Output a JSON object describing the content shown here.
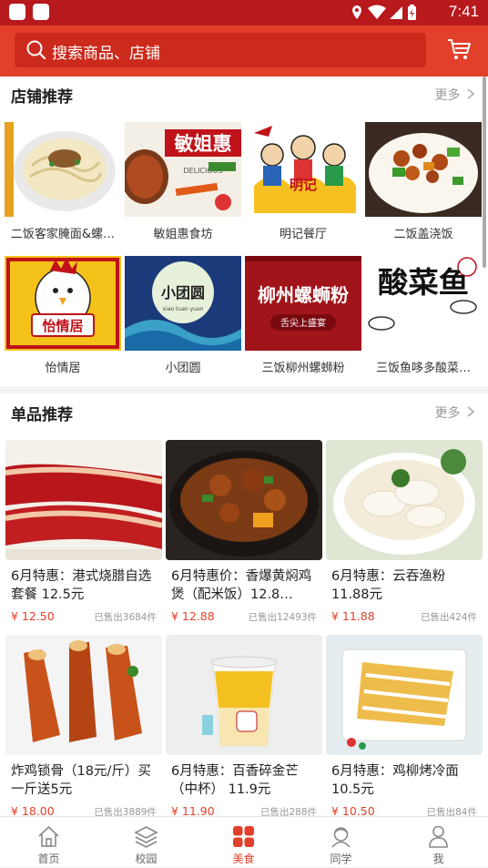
{
  "status_bar": {
    "time": "7:41"
  },
  "search": {
    "placeholder": "搜索商品、店铺"
  },
  "shops_section": {
    "title": "店铺推荐",
    "more": "更多",
    "shops": [
      {
        "name": "二饭客家腌面&螺…"
      },
      {
        "name": "敏姐惠食坊",
        "sign": "敏姐惠",
        "sub": "DELICIOUS"
      },
      {
        "name": "明记餐厅",
        "sign": "明记"
      },
      {
        "name": "二饭盖浇饭"
      },
      {
        "name": "怡情居",
        "sign": "怡情居"
      },
      {
        "name": "小团圆",
        "sign": "小团圆",
        "sub": "xiao tuan yuan"
      },
      {
        "name": "三饭柳州螺蛳粉",
        "sign": "柳州螺蛳粉",
        "sub": "舌尖上盛宴"
      },
      {
        "name": "三饭鱼哆多酸菜…",
        "sign": "酸菜鱼"
      }
    ]
  },
  "products_section": {
    "title": "单品推荐",
    "more": "更多",
    "products": [
      {
        "title": "6月特惠：港式烧腊自选套餐 12.5元",
        "price": "¥ 12.50",
        "sold": "已售出3684件"
      },
      {
        "title": "6月特惠价：香爆黄焖鸡煲（配米饭）12.8…",
        "price": "¥ 12.88",
        "sold": "已售出12493件"
      },
      {
        "title": "6月特惠：云吞渔粉 11.88元",
        "price": "¥ 11.88",
        "sold": "已售出424件"
      },
      {
        "title": "炸鸡锁骨（18元/斤）买一斤送5元",
        "price": "¥ 18.00",
        "sold": "已售出3889件"
      },
      {
        "title": "6月特惠：百香碎金芒（中杯） 11.9元",
        "price": "¥ 11.90",
        "sold": "已售出288件"
      },
      {
        "title": "6月特惠：鸡柳烤冷面 10.5元",
        "price": "¥ 10.50",
        "sold": "已售出84件"
      }
    ]
  },
  "tabs": [
    {
      "label": "首页",
      "icon": "home-icon"
    },
    {
      "label": "校园",
      "icon": "layers-icon"
    },
    {
      "label": "美食",
      "icon": "food-grid-icon",
      "active": true
    },
    {
      "label": "同学",
      "icon": "classmates-icon"
    },
    {
      "label": "我",
      "icon": "person-icon"
    }
  ],
  "colors": {
    "header": "#e2402a",
    "status_bar": "#b8191c",
    "accent": "#e2402a"
  }
}
